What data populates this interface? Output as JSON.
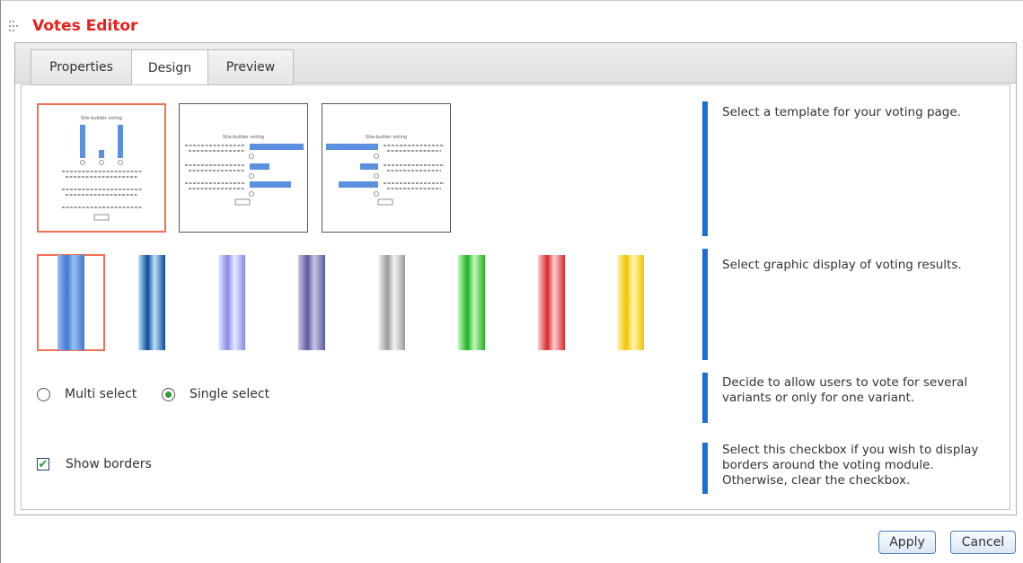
{
  "window": {
    "title": "Votes Editor"
  },
  "tabs": [
    {
      "label": "Properties"
    },
    {
      "label": "Design"
    },
    {
      "label": "Preview"
    }
  ],
  "active_tab": "Design",
  "templates": {
    "preview_heading": "Site-builder voting",
    "selected_index": 0
  },
  "bar_styles": {
    "selected_index": 0,
    "colors": [
      {
        "name": "blue",
        "dark": "#3a78d2",
        "light": "#9cc0ee"
      },
      {
        "name": "sky-blue",
        "dark": "#0a4a9a",
        "light": "#bfe4fa"
      },
      {
        "name": "lavender",
        "dark": "#8888e8",
        "light": "#e4ecff"
      },
      {
        "name": "slate-purple",
        "dark": "#5a5a9e",
        "light": "#c8c8e8"
      },
      {
        "name": "gray",
        "dark": "#9a9a9a",
        "light": "#f4f4f4"
      },
      {
        "name": "green",
        "dark": "#22b022",
        "light": "#c8f8c0"
      },
      {
        "name": "red",
        "dark": "#d82828",
        "light": "#fbd0d0"
      },
      {
        "name": "yellow",
        "dark": "#f4c400",
        "light": "#fff8b0"
      }
    ]
  },
  "selection_mode": {
    "options": [
      {
        "label": "Multi select",
        "selected": false
      },
      {
        "label": "Single select",
        "selected": true
      }
    ]
  },
  "show_borders": {
    "label": "Show borders",
    "checked": true
  },
  "descriptions": {
    "templates": "Select a template for your voting page.",
    "bars": "Select graphic display of voting results.",
    "selection": "Decide to allow users to vote for several variants or only for one variant.",
    "borders": "Select this checkbox if you wish to display borders around the voting module. Otherwise, clear the checkbox."
  },
  "buttons": {
    "apply": "Apply",
    "cancel": "Cancel"
  },
  "colors": {
    "title": "#e8201a",
    "accent_bar": "#1e6fd0",
    "selection_border": "#f07050"
  }
}
